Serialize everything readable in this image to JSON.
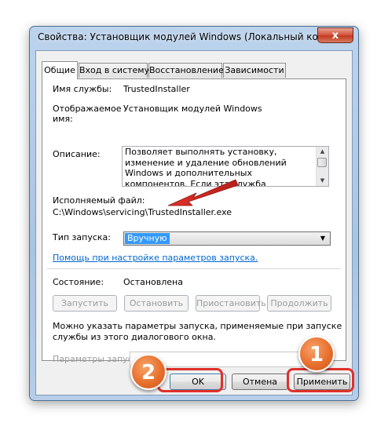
{
  "window": {
    "title": "Свойства: Установщик модулей Windows (Локальный компьют...",
    "close_glyph": "x"
  },
  "tabs": [
    {
      "label": "Общие",
      "active": true
    },
    {
      "label": "Вход в систему",
      "active": false
    },
    {
      "label": "Восстановление",
      "active": false
    },
    {
      "label": "Зависимости",
      "active": false
    }
  ],
  "general": {
    "service_name_label": "Имя службы:",
    "service_name_value": "TrustedInstaller",
    "display_name_label_1": "Отображаемое",
    "display_name_label_2": "имя:",
    "display_name_value": "Установщик модулей Windows",
    "description_label": "Описание:",
    "description_text": "Позволяет выполнять установку, изменение и удаление обновлений Windows и дополнительных компонентов. Если эта служба отключена, установка или удаление обновлений",
    "executable_label": "Исполняемый файл:",
    "executable_value": "C:\\Windows\\servicing\\TrustedInstaller.exe",
    "startup_type_label": "Тип запуска:",
    "startup_type_value": "Вручную",
    "help_link": "Помощь при настройке параметров запуска.",
    "status_label": "Состояние:",
    "status_value": "Остановлена",
    "service_buttons": {
      "start": "Запустить",
      "stop": "Остановить",
      "pause": "Приостановить",
      "resume": "Продолжить"
    },
    "params_hint_1": "Можно указать параметры запуска, применяемые при запуске",
    "params_hint_2": "службы из этого диалогового окна.",
    "params_label": "Параметры запуска:"
  },
  "footer_buttons": {
    "ok": "OK",
    "cancel": "Отмена",
    "apply": "Применить"
  },
  "annotations": {
    "badge_1": "1",
    "badge_2": "2",
    "accent_color": "#e0302a",
    "badge_color": "#e8702e"
  }
}
